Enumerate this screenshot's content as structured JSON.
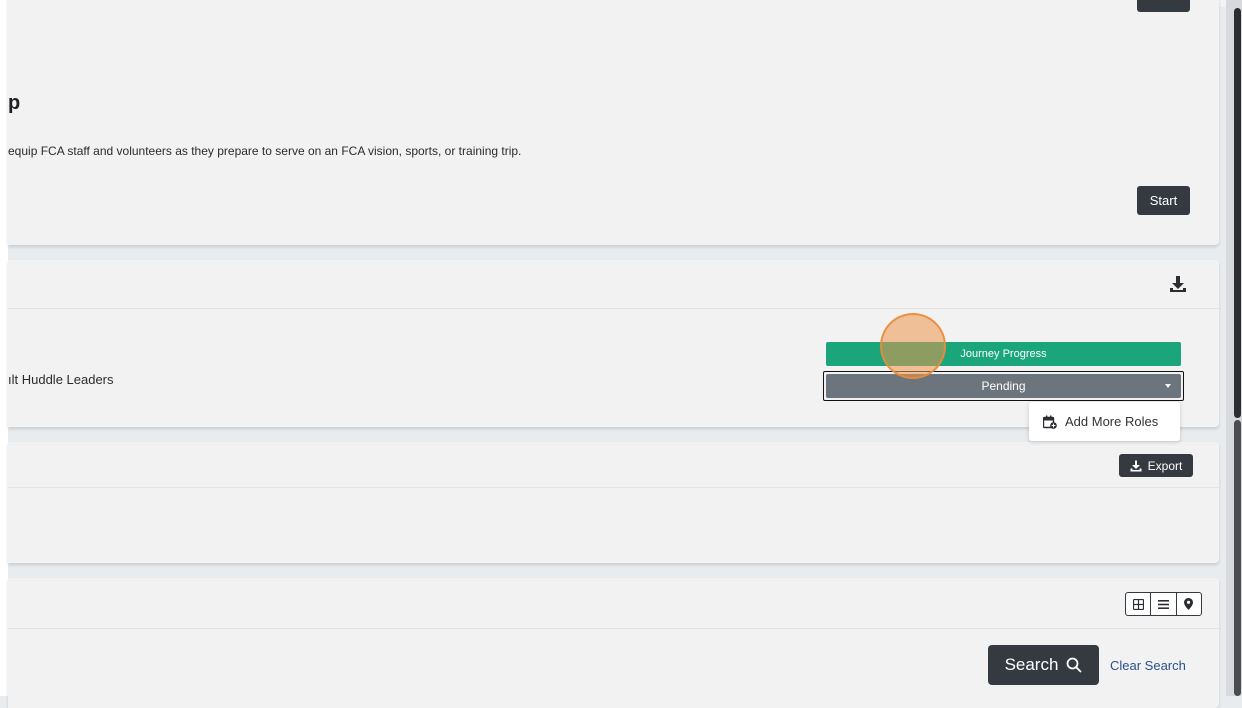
{
  "card_trip": {
    "title_fragment": "p",
    "description": "equip FCA staff and volunteers as they prepare to serve on an FCA vision, sports, or training trip.",
    "start_label": "Start"
  },
  "card_roles": {
    "role_text": "ılt Huddle Leaders",
    "journey_label": "Journey Progress",
    "status_label": "Pending",
    "menu_item_label": "Add More Roles"
  },
  "card_export": {
    "export_label": "Export"
  },
  "card_search": {
    "search_label": "Search",
    "clear_label": "Clear Search",
    "view_icons": [
      "grid-view-icon",
      "list-view-icon",
      "map-view-icon"
    ]
  },
  "colors": {
    "journey_green": "#1aa67a",
    "pending_gray": "#6c757d",
    "dark_button": "#343a40",
    "link_blue": "#2a4f8f",
    "click_marker": "#ec964c"
  }
}
